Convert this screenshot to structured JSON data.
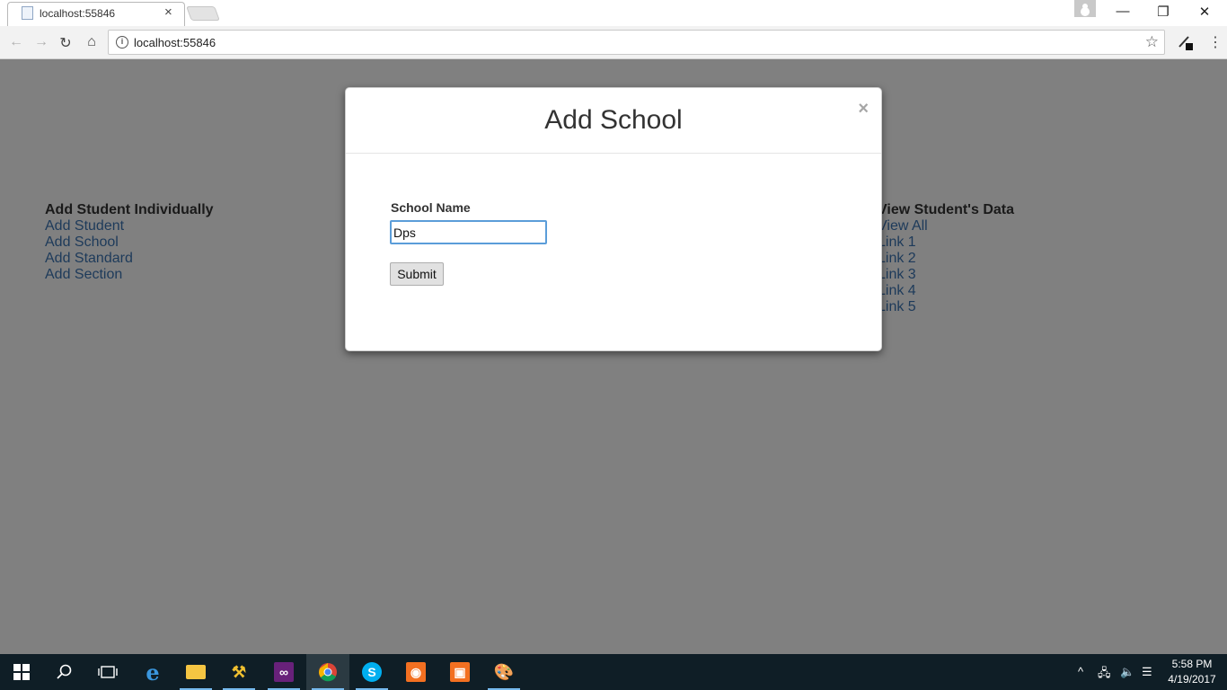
{
  "browser": {
    "tab_title": "localhost:55846",
    "tab_close": "×",
    "url": "localhost:55846"
  },
  "page": {
    "left_column": {
      "heading": "Add Student Individually",
      "links": [
        "Add Student",
        "Add School",
        "Add Standard",
        "Add Section"
      ]
    },
    "right_column": {
      "heading": "View Student's Data",
      "links": [
        "View All",
        "Link 1",
        "Link 2",
        "Link 3",
        "Link 4",
        "Link 5"
      ]
    }
  },
  "modal": {
    "title": "Add School",
    "close_label": "×",
    "field_label": "School Name",
    "field_value": "Dps",
    "submit_label": "Submit"
  },
  "taskbar": {
    "time": "5:58 PM",
    "date": "4/19/2017",
    "apps": [
      "start-icon",
      "search-icon",
      "task-view-icon",
      "edge-icon",
      "file-explorer-icon",
      "tools-icon",
      "visual-studio-icon",
      "chrome-icon",
      "skype-icon",
      "app-orange-icon",
      "app-orange2-icon",
      "paint-icon"
    ]
  },
  "colors": {
    "overlay": "#808080",
    "link": "#1d3a5a",
    "input_focus": "#5b9dd9",
    "taskbar": "#0f1e26"
  }
}
